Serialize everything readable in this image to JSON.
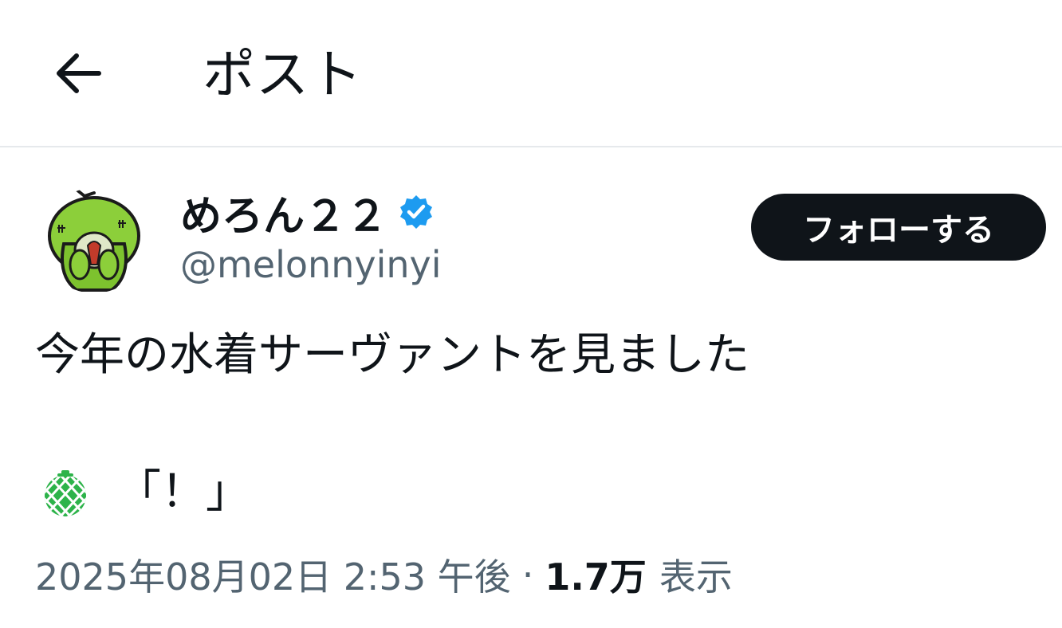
{
  "header": {
    "back_icon": "arrow-left-icon",
    "title": "ポスト"
  },
  "author": {
    "display_name": "めろん２２",
    "verified_icon": "verified-badge-icon",
    "handle": "@melonnyinyi",
    "follow_label": "フォローする"
  },
  "post": {
    "text": "今年の水着サーヴァントを見ました",
    "emoji_icon": "melon-icon",
    "quote": "「！」"
  },
  "meta": {
    "timestamp": "2025年08月02日 2:53 午後",
    "separator": "·",
    "views_count": "1.7万",
    "views_label": "表示"
  },
  "colors": {
    "text_primary": "#0f1419",
    "text_secondary": "#536471",
    "verified_blue": "#1d9bf0",
    "follow_bg": "#0f1419",
    "divider": "#e6e9ec"
  }
}
